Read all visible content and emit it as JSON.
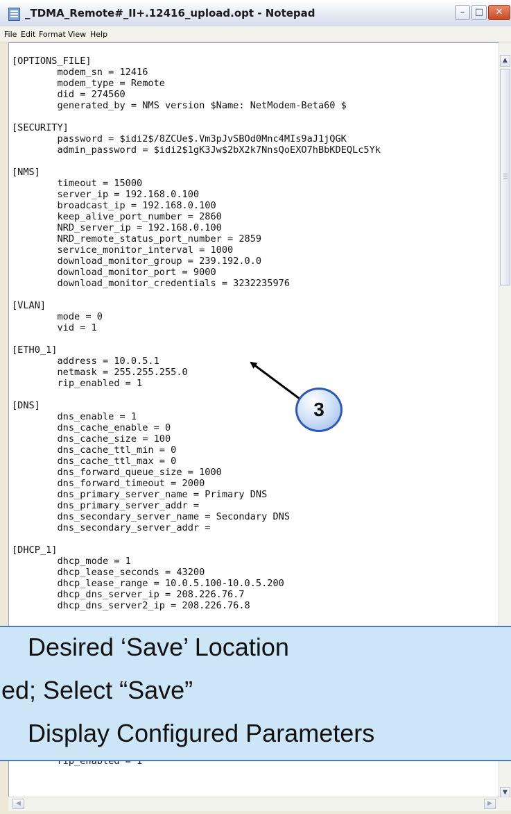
{
  "window": {
    "title": "_TDMA_Remote#_II+.12416_upload.opt - Notepad",
    "minimize_glyph": "–",
    "maximize_glyph": "□",
    "close_glyph": "✕"
  },
  "menu": [
    "File",
    "Edit",
    "Format",
    "View",
    "Help"
  ],
  "editor": {
    "lines": [
      "[OPTIONS_FILE]",
      "        modem_sn = 12416",
      "        modem_type = Remote",
      "        did = 274560",
      "        generated_by = NMS version $Name: NetModem-Beta60 $",
      "",
      "[SECURITY]",
      "        password = $idi2$/8ZCUe$.Vm3pJvSBOd0Mnc4MIs9aJ1jQGK",
      "        admin_password = $idi2$1gK3Jw$2bX2k7NnsQoEXO7hBbKDEQLc5Yk",
      "",
      "[NMS]",
      "        timeout = 15000",
      "        server_ip = 192.168.0.100",
      "        broadcast_ip = 192.168.0.100",
      "        keep_alive_port_number = 2860",
      "        NRD_server_ip = 192.168.0.100",
      "        NRD_remote_status_port_number = 2859",
      "        service_monitor_interval = 1000",
      "        download_monitor_group = 239.192.0.0",
      "        download_monitor_port = 9000",
      "        download_monitor_credentials = 3232235976",
      "",
      "[VLAN]",
      "        mode = 0",
      "        vid = 1",
      "",
      "[ETH0_1]",
      "        address = 10.0.5.1",
      "        netmask = 255.255.255.0",
      "        rip_enabled = 1",
      "",
      "[DNS]",
      "        dns_enable = 1",
      "        dns_cache_enable = 0",
      "        dns_cache_size = 100",
      "        dns_cache_ttl_min = 0",
      "        dns_cache_ttl_max = 0",
      "        dns_forward_queue_size = 1000",
      "        dns_forward_timeout = 2000",
      "        dns_primary_server_name = Primary DNS",
      "        dns_primary_server_addr =",
      "        dns_secondary_server_name = Secondary DNS",
      "        dns_secondary_server_addr =",
      "",
      "[DHCP_1]",
      "        dhcp_mode = 1",
      "        dhcp_lease_seconds = 43200",
      "        dhcp_lease_range = 10.0.5.100-10.0.5.200",
      "        dhcp_dns_server_ip = 208.226.76.7",
      "        dhcp_dns_server2_ip = 208.226.76.8",
      "",
      "",
      "",
      "",
      "",
      "",
      "",
      "",
      "",
      "",
      "",
      "",
      "        netmask = 255.255.255.0",
      "        rip_enabled = 1"
    ]
  },
  "callout": {
    "label": "3"
  },
  "overlay": {
    "line1": "Desired ‘Save’ Location",
    "line2": "ed; Select “Save”",
    "line3": "Display Configured Parameters"
  },
  "scrollbar": {
    "up_glyph": "▲",
    "down_glyph": "▼",
    "left_glyph": "◀",
    "right_glyph": "▶"
  },
  "colors": {
    "banner_bg": "#cde6f7",
    "banner_border": "#4a79b6",
    "callout_border": "#2b59b3"
  }
}
